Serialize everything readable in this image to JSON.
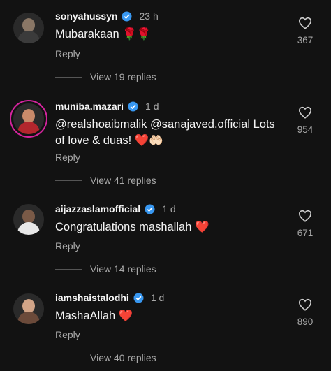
{
  "comments": [
    {
      "username": "sonyahussyn",
      "time": "23 h",
      "text": "Mubarakaan 🌹🌹",
      "reply_label": "Reply",
      "view_replies": "View 19 replies",
      "likes": "367",
      "verified": true
    },
    {
      "username": "muniba.mazari",
      "time": "1 d",
      "text": "@realshoaibmalik @sanajaved.official Lots of love & duas! ❤️🤲🏻",
      "reply_label": "Reply",
      "view_replies": "View 41 replies",
      "likes": "954",
      "verified": true
    },
    {
      "username": "aijazzaslamofficial",
      "time": "1 d",
      "text": "Congratulations mashallah ❤️",
      "reply_label": "Reply",
      "view_replies": "View 14 replies",
      "likes": "671",
      "verified": true
    },
    {
      "username": "iamshaistalodhi",
      "time": "1 d",
      "text": "MashaAllah ❤️",
      "reply_label": "Reply",
      "view_replies": "View 40 replies",
      "likes": "890",
      "verified": true
    }
  ],
  "icons": {
    "verified": "verified-badge-icon",
    "like": "heart-outline-icon"
  },
  "colors": {
    "background": "#121212",
    "verified": "#3897f0",
    "secondary_text": "#a8a8a8"
  }
}
